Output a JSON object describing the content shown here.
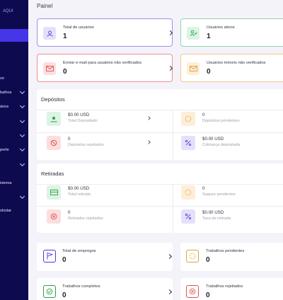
{
  "sidebar": {
    "brand": "AQUI",
    "items": [
      {
        "label": "vo",
        "chevron": false
      },
      {
        "label": "balhos",
        "chevron": true
      },
      {
        "label": "ários",
        "chevron": true
      },
      {
        "label": "",
        "chevron": true
      },
      {
        "label": "",
        "chevron": true
      },
      {
        "label": "porte",
        "chevron": true
      },
      {
        "label": "",
        "chevron": true
      },
      {
        "label": "istema",
        "chevron": false
      },
      {
        "label": "",
        "chevron": true
      },
      {
        "label": "olicitar",
        "chevron": false
      }
    ]
  },
  "main": {
    "title": "Painel",
    "stats": [
      {
        "label": "Total de usuários",
        "value": "1",
        "icon": "users-icon"
      },
      {
        "label": "Usuários ativos",
        "value": "1",
        "icon": "user-check-icon"
      },
      {
        "label": "Enviar e-mail para usuários não verificados",
        "value": "0",
        "icon": "envelope-icon"
      },
      {
        "label": "Usuários móveis não verificados",
        "value": "0",
        "icon": "mobile-envelope-icon"
      }
    ],
    "deposits": {
      "title": "Depósitos",
      "items": [
        {
          "value": "$0.00 USD",
          "label": "Total Depositado",
          "icon": "hand-money-icon"
        },
        {
          "value": "0",
          "label": "Depósitos pendentes",
          "icon": "spinner-icon"
        },
        {
          "value": "0",
          "label": "Depósitos rejeitados",
          "icon": "ban-icon"
        },
        {
          "value": "$0.00 USD",
          "label": "Cobrança depositada",
          "icon": "percent-icon"
        }
      ]
    },
    "withdrawals": {
      "title": "Retiradas",
      "items": [
        {
          "value": "$0.00 USD",
          "label": "Total retirado",
          "icon": "cash-icon"
        },
        {
          "value": "0",
          "label": "Saques pendentes",
          "icon": "spinner-icon"
        },
        {
          "value": "0",
          "label": "Retirados rejeitados",
          "icon": "x-circle-icon"
        },
        {
          "value": "$0.00 USD",
          "label": "Taxa de retirada",
          "icon": "percent-icon"
        }
      ]
    },
    "jobs": [
      {
        "label": "Total de empregos",
        "value": "0",
        "icon": "flag-icon"
      },
      {
        "label": "Trabalhos pendentes",
        "value": "0",
        "icon": "spinner-icon"
      },
      {
        "label": "Trabalhos completos",
        "value": "0",
        "icon": "check-circle-icon"
      },
      {
        "label": "Trabalhos rejeitados",
        "value": "0",
        "icon": "x-circle-icon"
      }
    ]
  },
  "colors": {
    "sidebar_bg": "#0d0a4f",
    "accent": "#4636e8",
    "purple_border": "#9f90e8",
    "green_border": "#8fd7a6",
    "red_border": "#ef8f8f",
    "orange_border": "#f5c78e"
  }
}
